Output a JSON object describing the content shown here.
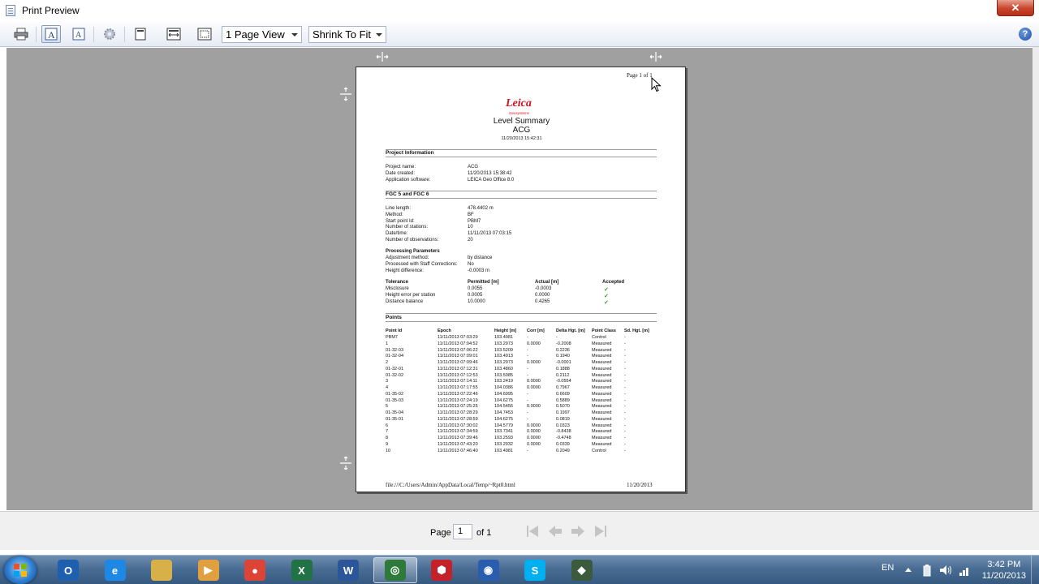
{
  "window": {
    "title": "Print Preview",
    "close_glyph": "✕"
  },
  "toolbar": {
    "view_combo": "1 Page View",
    "zoom_combo": "Shrink To Fit",
    "buttons": [
      "printer-icon",
      "text-size-a-icon",
      "text-size-a-small-icon",
      "settings-gear-icon",
      "page-icon",
      "page-width-icon",
      "page-fit-icon"
    ],
    "help_glyph": "?"
  },
  "report": {
    "page_number": "Page 1 of 1",
    "brand": "Leica",
    "brand_sub": "Geosystems",
    "title": "Level Summary",
    "subtitle": "ACG",
    "datetime": "11/20/2013 15:42:31",
    "project_section": "Project Information",
    "project_labels": [
      "Project name:",
      "Date created:",
      "Application software:"
    ],
    "project_values": [
      "ACG",
      "11/20/2013 15:38:42",
      "LEICA Geo Office 8.0"
    ],
    "fgc_section": "FGC 5 and FGC 6",
    "fgc_labels": [
      "Line length:",
      "Method:",
      "Start point Id:",
      "Number of stations:",
      "Date/time:",
      "Number of observations:"
    ],
    "fgc_values": [
      "478.4402 m",
      "BF",
      "PBM7",
      "10",
      "11/11/2013 07:03:15",
      "20"
    ],
    "processing_title": "Processing Parameters",
    "processing_labels": [
      "Adjustment method:",
      "Processed with Staff Corrections:",
      "Height difference:"
    ],
    "processing_values": [
      "by distance",
      "No",
      "-0.0003 m"
    ],
    "tolerance_headers": [
      "Tolerance",
      "Permitted [m]",
      "Actual [m]",
      "Accepted"
    ],
    "tolerance_rows": [
      [
        "Misclosure",
        "0.0055",
        "-0.0003",
        "✓"
      ],
      [
        "Height error per station",
        "0.0005",
        "0.0000",
        "✓"
      ],
      [
        "Distance balance",
        "10.0000",
        "0.4265",
        "✓"
      ]
    ],
    "points_section": "Points",
    "points_headers": [
      "Point Id",
      "Epoch",
      "Height [m]",
      "Corr [m]",
      "Delta Hgt. [m]",
      "Point Class",
      "Sd. Hgt. [m]"
    ],
    "points_rows": [
      [
        "PBM7",
        "11/11/2013 07:03:29",
        "103.4981",
        "-",
        "-",
        "Control",
        "-"
      ],
      [
        "1",
        "11/11/2013 07:04:52",
        "103.2973",
        "0.0000",
        "-0.2008",
        "Measured",
        "-"
      ],
      [
        "01-32-03",
        "11/11/2013 07:06:22",
        "103.5209",
        "-",
        "0.2236",
        "Measured",
        "-"
      ],
      [
        "01-32-04",
        "11/11/2013 07:09:01",
        "103.4913",
        "-",
        "0.1940",
        "Measured",
        "-"
      ],
      [
        "2",
        "11/11/2013 07:09:46",
        "103.2973",
        "0.0000",
        "-0.0001",
        "Measured",
        "-"
      ],
      [
        "01-32-01",
        "11/11/2013 07:12:31",
        "103.4860",
        "-",
        "0.1888",
        "Measured",
        "-"
      ],
      [
        "01-32-02",
        "11/11/2013 07:12:53",
        "103.5085",
        "-",
        "0.2112",
        "Measured",
        "-"
      ],
      [
        "3",
        "11/11/2013 07:14:11",
        "103.2419",
        "0.0000",
        "-0.0554",
        "Measured",
        "-"
      ],
      [
        "4",
        "11/11/2013 07:17:55",
        "104.0386",
        "0.0000",
        "0.7967",
        "Measured",
        "-"
      ],
      [
        "01-35-02",
        "11/11/2013 07:22:46",
        "104.6995",
        "-",
        "0.6609",
        "Measured",
        "-"
      ],
      [
        "01-35-03",
        "11/11/2013 07:24:19",
        "104.6275",
        "-",
        "0.5889",
        "Measured",
        "-"
      ],
      [
        "5",
        "11/11/2013 07:25:25",
        "104.5456",
        "0.0000",
        "0.5070",
        "Measured",
        "-"
      ],
      [
        "01-35-04",
        "11/11/2013 07:28:29",
        "104.7453",
        "-",
        "0.1997",
        "Measured",
        "-"
      ],
      [
        "01-35-01",
        "11/11/2013 07:28:59",
        "104.6275",
        "-",
        "0.0819",
        "Measured",
        "-"
      ],
      [
        "6",
        "11/11/2013 07:30:02",
        "104.5779",
        "0.0000",
        "0.0323",
        "Measured",
        "-"
      ],
      [
        "7",
        "11/11/2013 07:34:59",
        "103.7341",
        "0.0000",
        "-0.8438",
        "Measured",
        "-"
      ],
      [
        "8",
        "11/11/2013 07:39:46",
        "103.2593",
        "0.0000",
        "-0.4748",
        "Measured",
        "-"
      ],
      [
        "9",
        "11/11/2013 07:43:20",
        "103.2932",
        "0.0000",
        "0.0339",
        "Measured",
        "-"
      ],
      [
        "10",
        "11/11/2013 07:46:40",
        "103.4981",
        "-",
        "0.2049",
        "Control",
        "-"
      ]
    ],
    "footer_path": "file:///C:/Users/Admin/AppData/Local/Temp/~Rpt0.html",
    "footer_date": "11/20/2013"
  },
  "pager": {
    "label": "Page",
    "current": "1",
    "of": "of 1"
  },
  "taskbar": {
    "apps": [
      "outlook-icon",
      "internet-explorer-icon",
      "file-explorer-icon",
      "media-player-icon",
      "chrome-icon",
      "excel-icon",
      "word-icon",
      "leica-geo-office-icon",
      "acrobat-icon",
      "google-earth-icon",
      "skype-icon",
      "survey-tool-icon"
    ],
    "lang": "EN",
    "time": "3:42 PM",
    "date": "11/20/2013"
  }
}
